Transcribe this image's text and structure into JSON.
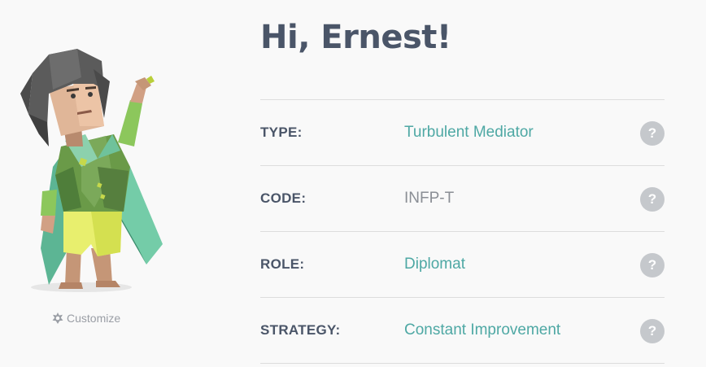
{
  "greeting": "Hi, Ernest!",
  "avatar": {
    "name": "mediator-avatar",
    "customize_icon": "gear-icon",
    "customize_label": "Customize"
  },
  "profile": {
    "rows": [
      {
        "label": "TYPE:",
        "value": "Turbulent Mediator",
        "help": "?"
      },
      {
        "label": "CODE:",
        "value": "INFP-T",
        "help": "?"
      },
      {
        "label": "ROLE:",
        "value": "Diplomat",
        "help": "?"
      },
      {
        "label": "STRATEGY:",
        "value": "Constant Improvement",
        "help": "?"
      }
    ]
  },
  "colors": {
    "heading": "#4a5568",
    "link": "#4ea8a4",
    "muted": "#8a8e95",
    "help_bg": "#c5c8cc",
    "divider": "#dddddd",
    "background": "#f9f9f9"
  }
}
